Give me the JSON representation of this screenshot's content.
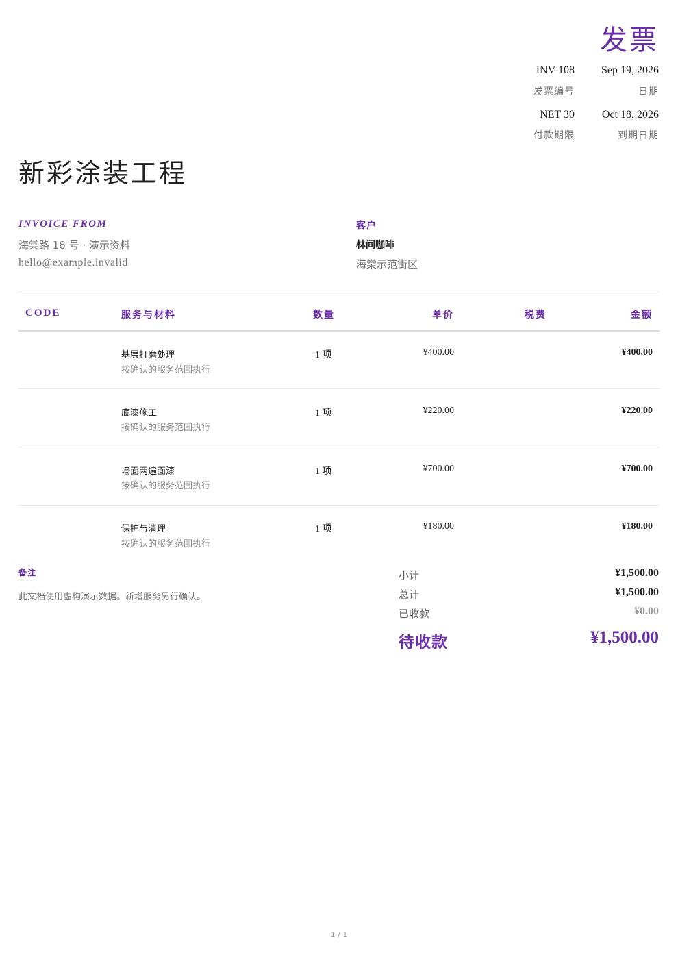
{
  "document": {
    "title": "发票",
    "invoice_number": "INV-108",
    "invoice_number_label": "发票编号",
    "date": "Sep 19, 2026",
    "date_label": "日期",
    "payment_terms": "NET 30",
    "payment_terms_label": "付款期限",
    "due_date": "Oct 18, 2026",
    "due_date_label": "到期日期",
    "project_title": "新彩涂装工程"
  },
  "from": {
    "heading": "INVOICE FROM",
    "address": "海棠路 18 号 · 演示资料",
    "email": "hello@example.invalid"
  },
  "client": {
    "heading": "客户",
    "name": "林间咖啡",
    "address": "海棠示范街区"
  },
  "table": {
    "headers": {
      "code": "CODE",
      "item": "服务与材料",
      "qty": "数量",
      "unit_price": "单价",
      "tax": "税费",
      "amount": "金额"
    },
    "rows": [
      {
        "code": "",
        "name": "基层打磨处理",
        "desc": "按确认的服务范围执行",
        "qty": "1 项",
        "unit_price": "¥400.00",
        "tax": "",
        "amount": "¥400.00"
      },
      {
        "code": "",
        "name": "底漆施工",
        "desc": "按确认的服务范围执行",
        "qty": "1 项",
        "unit_price": "¥220.00",
        "tax": "",
        "amount": "¥220.00"
      },
      {
        "code": "",
        "name": "墙面两遍面漆",
        "desc": "按确认的服务范围执行",
        "qty": "1 项",
        "unit_price": "¥700.00",
        "tax": "",
        "amount": "¥700.00"
      },
      {
        "code": "",
        "name": "保护与清理",
        "desc": "按确认的服务范围执行",
        "qty": "1 项",
        "unit_price": "¥180.00",
        "tax": "",
        "amount": "¥180.00"
      }
    ]
  },
  "notes": {
    "heading": "备注",
    "text": "此文档使用虚构演示数据。新增服务另行确认。"
  },
  "totals": {
    "subtotal_label": "小计",
    "subtotal": "¥1,500.00",
    "total_label": "总计",
    "total": "¥1,500.00",
    "paid_label": "已收款",
    "paid": "¥0.00",
    "due_label": "待收款",
    "due": "¥1,500.00"
  },
  "footer": {
    "page": "1 / 1"
  },
  "colors": {
    "accent": "#6a2fa8"
  }
}
